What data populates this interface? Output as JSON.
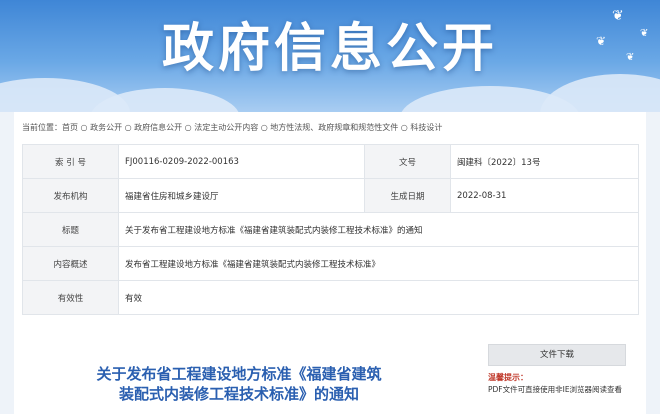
{
  "banner": {
    "title": "政府信息公开"
  },
  "breadcrumb": "当前位置：首页 ○ 政务公开 ○ 政府信息公开 ○ 法定主动公开内容 ○ 地方性法规、政府规章和规范性文件 ○ 科技设计",
  "info": {
    "index_label": "索 引 号",
    "index_value": "FJ00116-0209-2022-00163",
    "docno_label": "文号",
    "docno_value": "闽建科〔2022〕13号",
    "issuer_label": "发布机构",
    "issuer_value": "福建省住房和城乡建设厅",
    "date_label": "生成日期",
    "date_value": "2022-08-31",
    "title_label": "标题",
    "title_value": "关于发布省工程建设地方标准《福建省建筑装配式内装修工程技术标准》的通知",
    "summary_label": "内容概述",
    "summary_value": "发布省工程建设地方标准《福建省建筑装配式内装修工程技术标准》",
    "validity_label": "有效性",
    "validity_value": "有效"
  },
  "document": {
    "title_line1": "关于发布省工程建设地方标准《福建省建筑",
    "title_line2": "装配式内装修工程技术标准》的通知"
  },
  "sidebar": {
    "download_label": "文件下载",
    "tip_label": "温馨提示：",
    "tip_text": "PDF文件可直接使用非IE浏览器阅读查看"
  }
}
